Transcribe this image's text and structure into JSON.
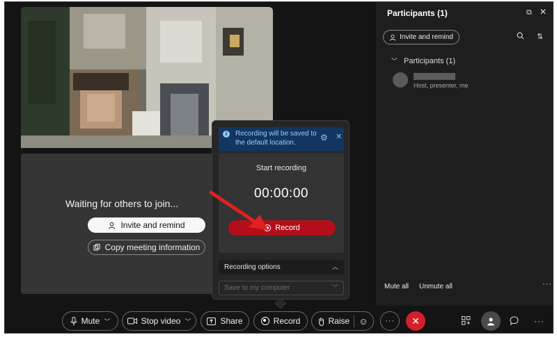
{
  "stage": {
    "waiting_text": "Waiting for others to join...",
    "invite_button": "Invite and remind",
    "copy_button": "Copy meeting information"
  },
  "record_popover": {
    "info_text": "Recording will be saved to the default location.",
    "title": "Start recording",
    "timer": "00:00:00",
    "record_button": "Record",
    "options_label": "Recording options",
    "save_placeholder": "Save to my computer"
  },
  "participants_panel": {
    "title": "Participants (1)",
    "invite_button": "Invite and remind",
    "group_label": "Participants (1)",
    "participant_role": "Host, presenter, me",
    "mute_all": "Mute all",
    "unmute_all": "Unmute all"
  },
  "toolbar": {
    "mute": "Mute",
    "stop_video": "Stop video",
    "share": "Share",
    "record": "Record",
    "raise": "Raise"
  },
  "colors": {
    "record_red": "#b30f1a",
    "end_call_red": "#d41f2c",
    "info_banner": "#12365f",
    "arrow_red": "#e02020"
  }
}
